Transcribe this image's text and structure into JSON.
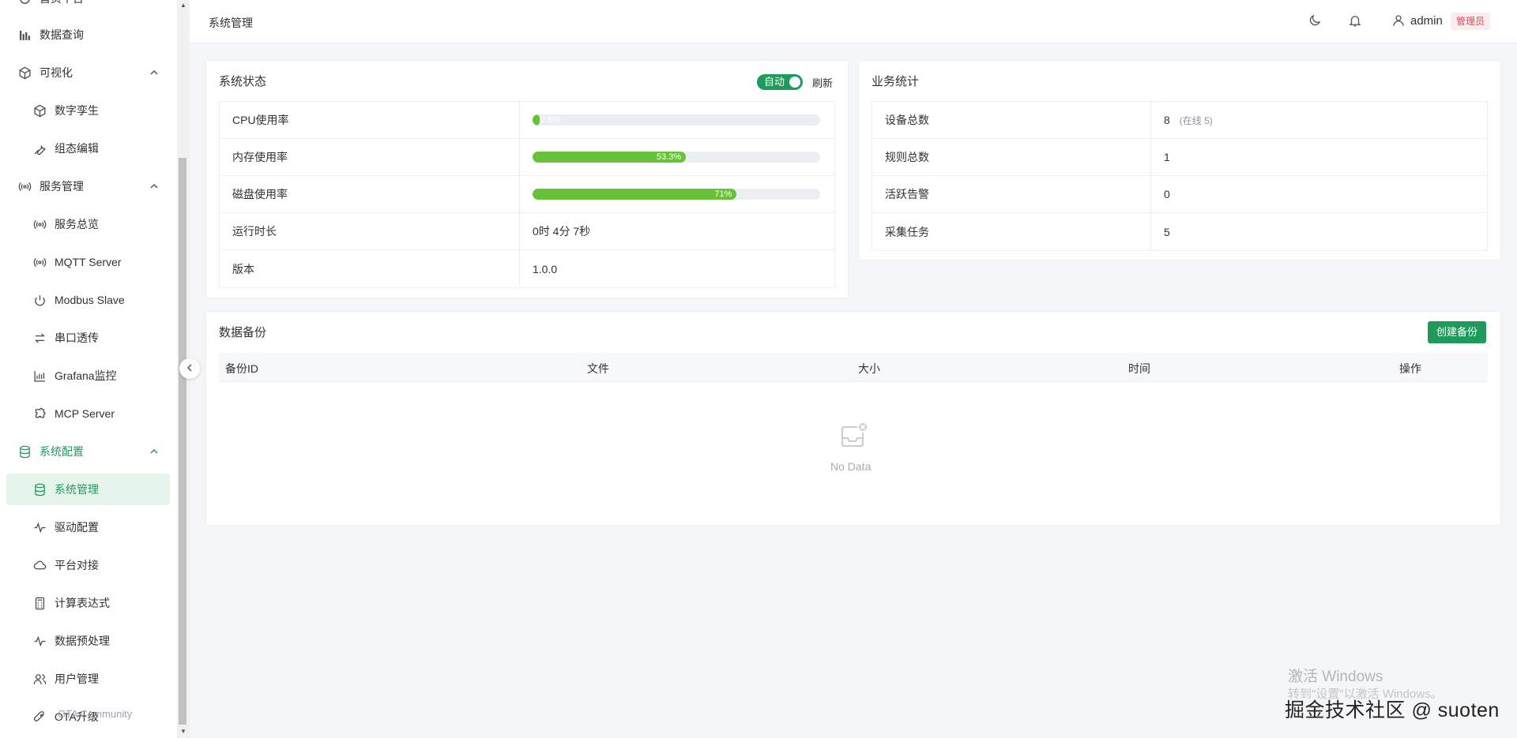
{
  "sidebar": {
    "items": [
      {
        "label": "首页平台",
        "icon": "home-icon"
      },
      {
        "label": "数据查询",
        "icon": "bar-chart-icon"
      },
      {
        "label": "可视化",
        "icon": "cube-icon"
      },
      {
        "label": "数字孪生",
        "icon": "cube-icon"
      },
      {
        "label": "组态编辑",
        "icon": "wrench-icon"
      },
      {
        "label": "服务管理",
        "icon": "broadcast-icon"
      },
      {
        "label": "服务总览",
        "icon": "broadcast-icon"
      },
      {
        "label": "MQTT Server",
        "icon": "broadcast-icon"
      },
      {
        "label": "Modbus Slave",
        "icon": "power-icon"
      },
      {
        "label": "串口透传",
        "icon": "swap-icon"
      },
      {
        "label": "Grafana监控",
        "icon": "chart-bars-icon"
      },
      {
        "label": "MCP Server",
        "icon": "puzzle-icon"
      },
      {
        "label": "系统配置",
        "icon": "database-icon"
      },
      {
        "label": "系统管理",
        "icon": "database-icon"
      },
      {
        "label": "驱动配置",
        "icon": "pulse-icon"
      },
      {
        "label": "平台对接",
        "icon": "cloud-icon"
      },
      {
        "label": "计算表达式",
        "icon": "calculator-icon"
      },
      {
        "label": "数据预处理",
        "icon": "pulse-icon"
      },
      {
        "label": "用户管理",
        "icon": "users-icon"
      },
      {
        "label": "OTA升级",
        "icon": "rocket-icon"
      }
    ],
    "community": "OTA Community"
  },
  "header": {
    "title": "系统管理",
    "user": "admin",
    "role": "管理员"
  },
  "status": {
    "title": "系统状态",
    "auto_label": "自动",
    "refresh_label": "刷新",
    "rows": [
      {
        "label": "CPU使用率",
        "progress": 2.5,
        "text": "2.5%"
      },
      {
        "label": "内存使用率",
        "progress": 53.3,
        "text": "53.3%"
      },
      {
        "label": "磁盘使用率",
        "progress": 71,
        "text": "71%"
      },
      {
        "label": "运行时长",
        "value": "0时 4分 7秒"
      },
      {
        "label": "版本",
        "value": "1.0.0"
      }
    ]
  },
  "stats": {
    "title": "业务统计",
    "rows": [
      {
        "label": "设备总数",
        "value": "8",
        "extra": "(在线 5)"
      },
      {
        "label": "规则总数",
        "value": "1"
      },
      {
        "label": "活跃告警",
        "value": "0"
      },
      {
        "label": "采集任务",
        "value": "5"
      }
    ]
  },
  "backup": {
    "title": "数据备份",
    "create_label": "创建备份",
    "columns": [
      "备份ID",
      "文件",
      "大小",
      "时间",
      "操作"
    ],
    "empty_text": "No Data"
  },
  "watermark": {
    "line1": "激活 Windows",
    "line2": "转到\"设置\"以激活 Windows。",
    "line3": "掘金技术社区 @ suoten"
  },
  "colors": {
    "accent": "#1f9a5b",
    "progress": "#67c23a",
    "badge": "#e0485a"
  }
}
